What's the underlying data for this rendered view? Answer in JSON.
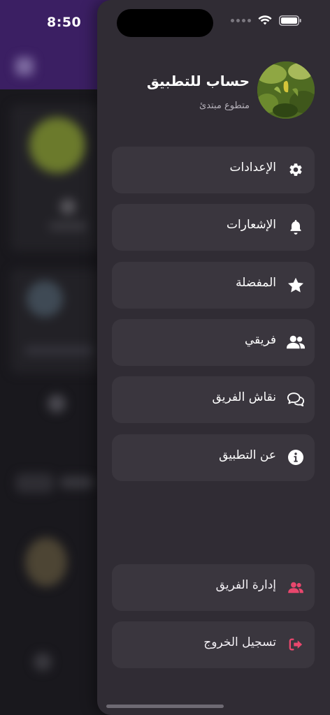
{
  "status_bar": {
    "time": "8:50"
  },
  "profile": {
    "name": "حساب للتطبيق",
    "role": "متطوع مبتدئ"
  },
  "menu": [
    {
      "label": "الإعدادات",
      "icon": "gear-icon"
    },
    {
      "label": "الإشعارات",
      "icon": "bell-icon"
    },
    {
      "label": "المفضلة",
      "icon": "star-icon"
    },
    {
      "label": "فريقي",
      "icon": "users-icon"
    },
    {
      "label": "نقاش الفريق",
      "icon": "chat-bubbles-icon"
    },
    {
      "label": "عن التطبيق",
      "icon": "info-icon"
    }
  ],
  "admin_menu": [
    {
      "label": "إدارة الفريق",
      "icon": "users-icon"
    },
    {
      "label": "تسجيل الخروج",
      "icon": "logout-icon"
    }
  ],
  "colors": {
    "drawer_bg": "#302c34",
    "item_bg": "#3a363e",
    "accent_pink": "#e8476d",
    "header_purple": "#3b1f63"
  }
}
